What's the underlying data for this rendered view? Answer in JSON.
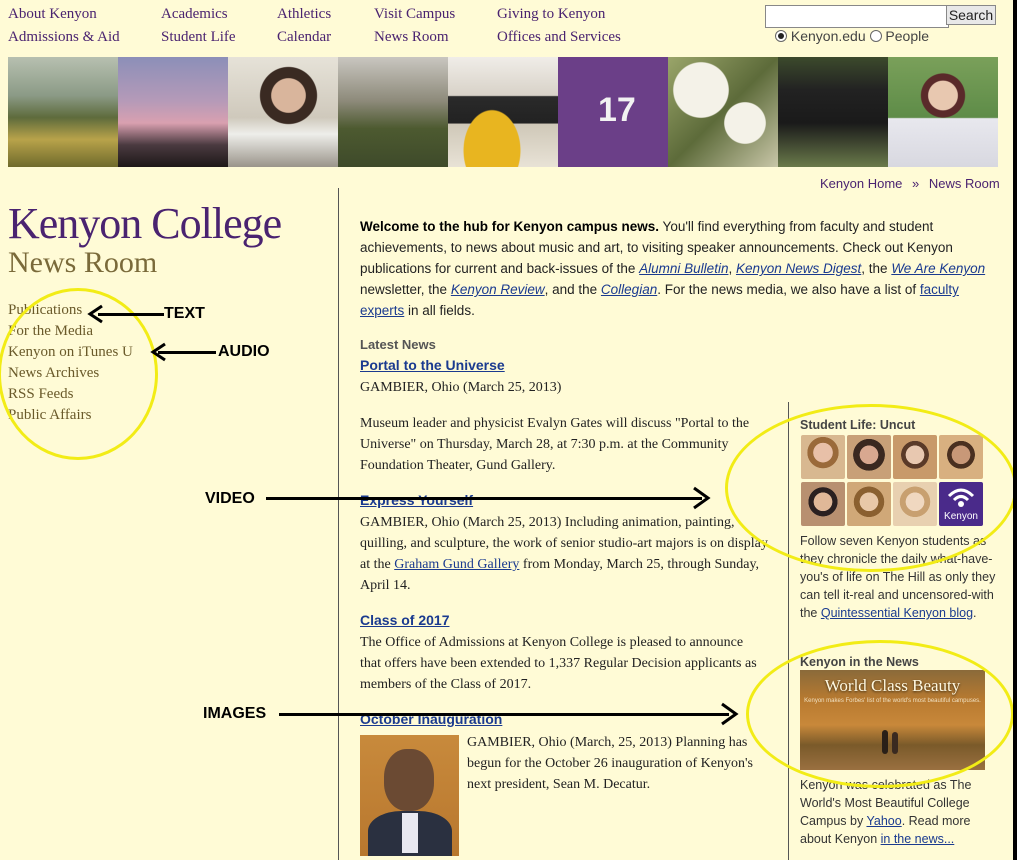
{
  "topnav": [
    {
      "label": "About Kenyon"
    },
    {
      "label": "Admissions & Aid"
    },
    {
      "label": "Academics"
    },
    {
      "label": "Student Life"
    },
    {
      "label": "Athletics"
    },
    {
      "label": "Calendar"
    },
    {
      "label": "Visit Campus"
    },
    {
      "label": "News Room"
    },
    {
      "label": "Giving to Kenyon"
    },
    {
      "label": "Offices and Services"
    }
  ],
  "search": {
    "button": "Search",
    "value": "",
    "opt1": "Kenyon.edu",
    "opt2": "People"
  },
  "breadcrumb": {
    "home": "Kenyon Home",
    "sep": "»",
    "current": "News Room"
  },
  "logo": {
    "main": "Kenyon College",
    "sub": "News Room"
  },
  "sidebar": [
    "Publications",
    "For the Media",
    "Kenyon on iTunes U",
    "News Archives",
    "RSS Feeds",
    "Public Affairs"
  ],
  "annotations": {
    "text": "TEXT",
    "audio": "AUDIO",
    "video": "VIDEO",
    "images": "IMAGES"
  },
  "intro": {
    "bold": "Welcome to the hub for Kenyon campus news.",
    "t1": " You'll find everything from faculty and student achievements, to news about music and art, to visiting speaker announcements. Check out Kenyon publications for current and back-issues of the ",
    "l1": "Alumni Bulletin",
    "t2": ", ",
    "l2": "Kenyon News Digest",
    "t3": ", the ",
    "l3": "We Are Kenyon",
    "t4": " newsletter, the ",
    "l4": "Kenyon Review",
    "t5": ", and the ",
    "l5": "Collegian",
    "t6": ". For the news media, we also have a list of ",
    "l6": "faculty experts",
    "t7": " in all fields."
  },
  "latest": {
    "heading": "Latest News",
    "items": [
      {
        "title": "Portal to the Universe",
        "date": "GAMBIER, Ohio (March 25, 2013)",
        "body": "Museum leader and physicist Evalyn Gates will discuss \"Portal to the Universe\" on Thursday, March 28, at 7:30 p.m. at the Community Foundation Theater, Gund Gallery."
      },
      {
        "title": "Express Yourself",
        "body_a": "GAMBIER, Ohio (March 25, 2013) Including animation, painting, quilling, and sculpture, the work of senior studio-art majors is on display at the ",
        "link": "Graham Gund Gallery",
        "body_b": " from Monday, March 25, through Sunday, April 14."
      },
      {
        "title": "Class of 2017",
        "body": "The Office of Admissions at Kenyon College is pleased to announce that offers have been extended to 1,337 Regular Decision applicants as members of the Class of 2017."
      },
      {
        "title": "October Inauguration",
        "body": "GAMBIER, Ohio (March, 25, 2013) Planning has begun for the October 26 inauguration of Kenyon's next president, Sean M. Decatur."
      }
    ]
  },
  "side": {
    "uncut_heading": "Student Life: Uncut",
    "uncut_text": "Follow seven Kenyon students as they chronicle the daily what-have-you's of life on The Hill as only they can tell it-real and uncensored-with the ",
    "uncut_link": "Quintessential Kenyon blog",
    "uncut_end": ".",
    "badge": "Kenyon",
    "news_heading": "Kenyon in the News",
    "news_img_title": "World Class Beauty",
    "news_img_caption": "Kenyon makes Forbes' list of the world's most beautiful campuses.",
    "news_text": "Kenyon was celebrated as The World's Most Beautiful College Campus by ",
    "news_link1": "Yahoo",
    "news_text2": ". Read more about Kenyon ",
    "news_link2": "in the news..."
  },
  "colors": {
    "bg": "#fffbd6",
    "purple": "#4a2370",
    "link": "#1a3a8f",
    "highlight": "#f2ec16"
  }
}
